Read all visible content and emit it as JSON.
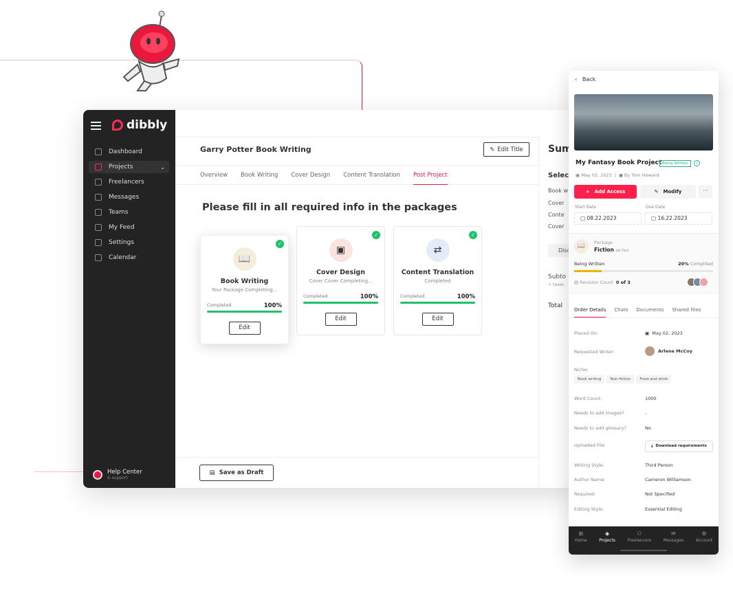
{
  "brand": {
    "name": "dibbly",
    "accent": "#ff1f4b"
  },
  "sidebar": {
    "items": [
      {
        "label": "Dashboard",
        "icon": "dashboard-icon"
      },
      {
        "label": "Projects",
        "icon": "layers-icon",
        "active": true
      },
      {
        "label": "Freelancers",
        "icon": "freelancers-icon"
      },
      {
        "label": "Messages",
        "icon": "messages-icon"
      },
      {
        "label": "Teams",
        "icon": "teams-icon"
      },
      {
        "label": "My Feed",
        "icon": "feed-icon"
      },
      {
        "label": "Settings",
        "icon": "gear-icon"
      },
      {
        "label": "Calendar",
        "icon": "calendar-icon"
      }
    ],
    "help": {
      "title": "Help Center",
      "subtitle": "& support"
    }
  },
  "header": {
    "title": "Garry Potter Book Writing",
    "edit_title": "Edit Title"
  },
  "tabs": [
    "Overview",
    "Book Writing",
    "Cover Design",
    "Content Translation",
    "Post Project"
  ],
  "main": {
    "heading": "Please fill in all required info in the packages",
    "cards": [
      {
        "name": "Book Writing",
        "sub": "Your Package Completing...",
        "label": "Completed",
        "percent": "100%",
        "edit": "Edit"
      },
      {
        "name": "Cover Design",
        "sub": "Cover Cover Completing...",
        "label": "Completed",
        "percent": "100%",
        "edit": "Edit"
      },
      {
        "name": "Content Translation",
        "sub": "Completed",
        "label": "Completed",
        "percent": "100%",
        "edit": "Edit"
      }
    ],
    "save_draft": "Save as Draft"
  },
  "summary": {
    "title": "Sum",
    "select": "Selec",
    "items": [
      "Book w",
      "Cover",
      "Conte",
      "Cover"
    ],
    "discount": "Disc",
    "subtotal": "Subto",
    "taxes": "+ taxes",
    "total": "Total"
  },
  "mobile": {
    "back": "Back",
    "title": "My Fantasy Book Project",
    "status": "Being Written",
    "date": "May 02, 2023",
    "author": "By Tom Howard",
    "add_access": "Add Access",
    "modify": "Modify",
    "more": "···",
    "start_label": "Start Date",
    "start": "08.22.2023",
    "due_label": "Due Date",
    "due": "16.22.2023",
    "package_label": "Package",
    "package": "Fiction",
    "tier": "(All Tier)",
    "progress_label": "Being Written",
    "progress_pct": "20%",
    "progress_text": "Complited",
    "progress": 20,
    "revision_label": "Revision Count",
    "revision": "0 of 3",
    "tabs": [
      "Order Details",
      "Chats",
      "Documents",
      "Shared Files"
    ],
    "details": {
      "placed_label": "Placed On:",
      "placed": "May 02, 2023",
      "writer_label": "Requested Writer:",
      "writer": "Arlene McCoy",
      "niche_label": "Niche:",
      "niches": [
        "Book writing",
        "Non-fiction",
        "Food and drink"
      ],
      "word_label": "Word Count:",
      "word": "1000",
      "images_label": "Needs to add images?",
      "images": "-",
      "glossary_label": "Needs to add glossary?",
      "glossary": "No",
      "file_label": "Uploaded File:",
      "download": "Download requirements",
      "style_label": "Writing Style:",
      "style": "Third Person",
      "author_label": "Author Name:",
      "author": "Cameron Williamson",
      "required_label": "Required:",
      "required": "Not Specified",
      "editing_label": "Editing Style:",
      "editing": "Essential Editing"
    },
    "bottom_nav": [
      "Home",
      "Projects",
      "Freelancers",
      "Messages",
      "Account"
    ]
  }
}
